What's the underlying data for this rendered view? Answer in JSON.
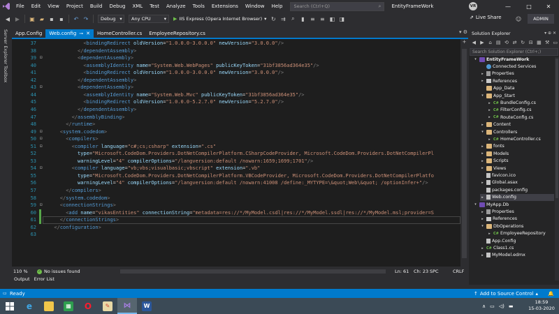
{
  "menu": {
    "items": [
      "File",
      "Edit",
      "View",
      "Project",
      "Build",
      "Debug",
      "XML",
      "Test",
      "Analyze",
      "Tools",
      "Extensions",
      "Window",
      "Help"
    ],
    "search_placeholder": "Search (Ctrl+Q)",
    "solution_name": "EntityFrameWork",
    "user_initials": "VR"
  },
  "toolbar": {
    "config": "Debug",
    "platform": "Any CPU",
    "run_label": "IIS Express (Opera Internet Browser)",
    "live_share": "Live Share",
    "admin": "ADMIN"
  },
  "side_tabs": [
    "Server Explorer",
    "Toolbox"
  ],
  "tabs": [
    {
      "label": "App.Config",
      "active": false
    },
    {
      "label": "Web.config",
      "active": true
    },
    {
      "label": "HomeController.cs",
      "active": false
    },
    {
      "label": "EmployeeRepository.cs",
      "active": false
    }
  ],
  "code": [
    {
      "n": "37",
      "i": 6,
      "s": [
        [
          "b",
          "<"
        ],
        [
          "t",
          "bindingRedirect "
        ],
        [
          "a",
          "oldVersion"
        ],
        [
          "p",
          "="
        ],
        [
          "v",
          "\"1.0.0.0-3.0.0.0\""
        ],
        [
          "p",
          " "
        ],
        [
          "a",
          "newVersion"
        ],
        [
          "p",
          "="
        ],
        [
          "v",
          "\"3.0.0.0\""
        ],
        [
          "b",
          "/>"
        ]
      ]
    },
    {
      "n": "38",
      "i": 5,
      "s": [
        [
          "b",
          "</"
        ],
        [
          "t",
          "dependentAssembly"
        ],
        [
          "b",
          ">"
        ]
      ]
    },
    {
      "n": "39",
      "i": 5,
      "f": "-",
      "s": [
        [
          "b",
          "<"
        ],
        [
          "t",
          "dependentAssembly"
        ],
        [
          "b",
          ">"
        ]
      ]
    },
    {
      "n": "40",
      "i": 6,
      "s": [
        [
          "b",
          "<"
        ],
        [
          "t",
          "assemblyIdentity "
        ],
        [
          "a",
          "name"
        ],
        [
          "p",
          "="
        ],
        [
          "v",
          "\"System.Web.WebPages\""
        ],
        [
          "p",
          " "
        ],
        [
          "a",
          "publicKeyToken"
        ],
        [
          "p",
          "="
        ],
        [
          "v",
          "\"31bf3856ad364e35\""
        ],
        [
          "b",
          "/>"
        ]
      ]
    },
    {
      "n": "41",
      "i": 6,
      "s": [
        [
          "b",
          "<"
        ],
        [
          "t",
          "bindingRedirect "
        ],
        [
          "a",
          "oldVersion"
        ],
        [
          "p",
          "="
        ],
        [
          "v",
          "\"1.0.0.0-3.0.0.0\""
        ],
        [
          "p",
          " "
        ],
        [
          "a",
          "newVersion"
        ],
        [
          "p",
          "="
        ],
        [
          "v",
          "\"3.0.0.0\""
        ],
        [
          "b",
          "/>"
        ]
      ]
    },
    {
      "n": "42",
      "i": 5,
      "s": [
        [
          "b",
          "</"
        ],
        [
          "t",
          "dependentAssembly"
        ],
        [
          "b",
          ">"
        ]
      ]
    },
    {
      "n": "43",
      "i": 5,
      "f": "-",
      "s": [
        [
          "b",
          "<"
        ],
        [
          "t",
          "dependentAssembly"
        ],
        [
          "b",
          ">"
        ]
      ]
    },
    {
      "n": "44",
      "i": 6,
      "s": [
        [
          "b",
          "<"
        ],
        [
          "t",
          "assemblyIdentity "
        ],
        [
          "a",
          "name"
        ],
        [
          "p",
          "="
        ],
        [
          "v",
          "\"System.Web.Mvc\""
        ],
        [
          "p",
          " "
        ],
        [
          "a",
          "publicKeyToken"
        ],
        [
          "p",
          "="
        ],
        [
          "v",
          "\"31bf3856ad364e35\""
        ],
        [
          "b",
          "/>"
        ]
      ]
    },
    {
      "n": "45",
      "i": 6,
      "s": [
        [
          "b",
          "<"
        ],
        [
          "t",
          "bindingRedirect "
        ],
        [
          "a",
          "oldVersion"
        ],
        [
          "p",
          "="
        ],
        [
          "v",
          "\"1.0.0.0-5.2.7.0\""
        ],
        [
          "p",
          " "
        ],
        [
          "a",
          "newVersion"
        ],
        [
          "p",
          "="
        ],
        [
          "v",
          "\"5.2.7.0\""
        ],
        [
          "b",
          "/>"
        ]
      ]
    },
    {
      "n": "46",
      "i": 5,
      "s": [
        [
          "b",
          "</"
        ],
        [
          "t",
          "dependentAssembly"
        ],
        [
          "b",
          ">"
        ]
      ]
    },
    {
      "n": "47",
      "i": 4,
      "s": [
        [
          "b",
          "</"
        ],
        [
          "t",
          "assemblyBinding"
        ],
        [
          "b",
          ">"
        ]
      ]
    },
    {
      "n": "48",
      "i": 3,
      "s": [
        [
          "b",
          "</"
        ],
        [
          "t",
          "runtime"
        ],
        [
          "b",
          ">"
        ]
      ]
    },
    {
      "n": "49",
      "i": 2,
      "f": "-",
      "s": [
        [
          "b",
          "<"
        ],
        [
          "t",
          "system.codedom"
        ],
        [
          "b",
          ">"
        ]
      ]
    },
    {
      "n": "50",
      "i": 3,
      "f": "-",
      "s": [
        [
          "b",
          "<"
        ],
        [
          "t",
          "compilers"
        ],
        [
          "b",
          ">"
        ]
      ]
    },
    {
      "n": "51",
      "i": 4,
      "f": "-",
      "s": [
        [
          "b",
          "<"
        ],
        [
          "t",
          "compiler "
        ],
        [
          "a",
          "language"
        ],
        [
          "p",
          "="
        ],
        [
          "v",
          "\"c#;cs;csharp\""
        ],
        [
          "p",
          " "
        ],
        [
          "a",
          "extension"
        ],
        [
          "p",
          "="
        ],
        [
          "v",
          "\".cs\""
        ]
      ]
    },
    {
      "n": "52",
      "i": 5,
      "s": [
        [
          "a",
          "type"
        ],
        [
          "p",
          "="
        ],
        [
          "v",
          "\"Microsoft.CodeDom.Providers.DotNetCompilerPlatform.CSharpCodeProvider, Microsoft.CodeDom.Providers.DotNetCompilerPl"
        ]
      ]
    },
    {
      "n": "53",
      "i": 5,
      "s": [
        [
          "a",
          "warningLevel"
        ],
        [
          "p",
          "="
        ],
        [
          "v",
          "\"4\""
        ],
        [
          "p",
          " "
        ],
        [
          "a",
          "compilerOptions"
        ],
        [
          "p",
          "="
        ],
        [
          "v",
          "\"/langversion:default /nowarn:1659;1699;1701\""
        ],
        [
          "b",
          "/>"
        ]
      ]
    },
    {
      "n": "54",
      "i": 4,
      "f": "-",
      "s": [
        [
          "b",
          "<"
        ],
        [
          "t",
          "compiler "
        ],
        [
          "a",
          "language"
        ],
        [
          "p",
          "="
        ],
        [
          "v",
          "\"vb;vbs;visualbasic;vbscript\""
        ],
        [
          "p",
          " "
        ],
        [
          "a",
          "extension"
        ],
        [
          "p",
          "="
        ],
        [
          "v",
          "\".vb\""
        ]
      ]
    },
    {
      "n": "55",
      "i": 5,
      "s": [
        [
          "a",
          "type"
        ],
        [
          "p",
          "="
        ],
        [
          "v",
          "\"Microsoft.CodeDom.Providers.DotNetCompilerPlatform.VBCodeProvider, Microsoft.CodeDom.Providers.DotNetCompilerPlatfo"
        ]
      ]
    },
    {
      "n": "56",
      "i": 5,
      "s": [
        [
          "a",
          "warningLevel"
        ],
        [
          "p",
          "="
        ],
        [
          "v",
          "\"4\""
        ],
        [
          "p",
          " "
        ],
        [
          "a",
          "compilerOptions"
        ],
        [
          "p",
          "="
        ],
        [
          "v",
          "\"/langversion:default /nowarn:41008 /define:_MYTYPE=\\&quot;Web\\&quot; /optionInfer+\""
        ],
        [
          "b",
          "/>"
        ]
      ]
    },
    {
      "n": "57",
      "i": 3,
      "s": [
        [
          "b",
          "</"
        ],
        [
          "t",
          "compilers"
        ],
        [
          "b",
          ">"
        ]
      ]
    },
    {
      "n": "58",
      "i": 2,
      "s": [
        [
          "b",
          "</"
        ],
        [
          "t",
          "system.codedom"
        ],
        [
          "b",
          ">"
        ]
      ]
    },
    {
      "n": "59",
      "i": 2,
      "f": "-",
      "s": [
        [
          "b",
          "<"
        ],
        [
          "t",
          "connectionStrings"
        ],
        [
          "b",
          ">"
        ]
      ]
    },
    {
      "n": "60",
      "i": 3,
      "s": [
        [
          "b",
          "<"
        ],
        [
          "t",
          "add "
        ],
        [
          "a",
          "name"
        ],
        [
          "p",
          "="
        ],
        [
          "v",
          "\"vikasEntities\""
        ],
        [
          "p",
          " "
        ],
        [
          "a",
          "connectionString"
        ],
        [
          "p",
          "="
        ],
        [
          "v",
          "\"metadata=res://*/MyModel.csdl|res://*/MyModel.ssdl|res://*/MyModel.msl;provider=S"
        ]
      ]
    },
    {
      "n": "61",
      "i": 2,
      "cur": true,
      "s": [
        [
          "b",
          "</"
        ],
        [
          "t",
          "connectionStrings"
        ],
        [
          "b",
          ">"
        ]
      ]
    },
    {
      "n": "62",
      "i": 1,
      "s": [
        [
          "b",
          "</"
        ],
        [
          "t",
          "configuration"
        ],
        [
          "b",
          ">"
        ]
      ]
    },
    {
      "n": "63",
      "i": 0,
      "s": []
    }
  ],
  "editor_status": {
    "zoom": "110 %",
    "issues": "No issues found",
    "line": "Ln: 61",
    "char": "Ch: 23",
    "ins": "SPC",
    "eol": "CRLF"
  },
  "panel_tabs": [
    "Output",
    "Error List"
  ],
  "solution_explorer": {
    "title": "Solution Explorer",
    "search_placeholder": "Search Solution Explorer (Ctrl+;)",
    "tree": [
      {
        "label": "EntityFrameWork",
        "d": 0,
        "tw": "▾",
        "icon": "proj",
        "bold": true
      },
      {
        "label": "Connected Services",
        "d": 1,
        "tw": "",
        "icon": "conn"
      },
      {
        "label": "Properties",
        "d": 1,
        "tw": "▸",
        "icon": "props"
      },
      {
        "label": "References",
        "d": 1,
        "tw": "▸",
        "icon": "refs"
      },
      {
        "label": "App_Data",
        "d": 1,
        "tw": "",
        "icon": "folder"
      },
      {
        "label": "App_Start",
        "d": 1,
        "tw": "▾",
        "icon": "folder"
      },
      {
        "label": "BundleConfig.cs",
        "d": 2,
        "tw": "▸",
        "icon": "cs"
      },
      {
        "label": "FilterConfig.cs",
        "d": 2,
        "tw": "▸",
        "icon": "cs"
      },
      {
        "label": "RouteConfig.cs",
        "d": 2,
        "tw": "▸",
        "icon": "cs"
      },
      {
        "label": "Content",
        "d": 1,
        "tw": "▸",
        "icon": "folder"
      },
      {
        "label": "Controllers",
        "d": 1,
        "tw": "▾",
        "icon": "folder"
      },
      {
        "label": "HomeController.cs",
        "d": 2,
        "tw": "▸",
        "icon": "cs"
      },
      {
        "label": "fonts",
        "d": 1,
        "tw": "▸",
        "icon": "folder"
      },
      {
        "label": "Models",
        "d": 1,
        "tw": "▸",
        "icon": "folder"
      },
      {
        "label": "Scripts",
        "d": 1,
        "tw": "▸",
        "icon": "folder"
      },
      {
        "label": "Views",
        "d": 1,
        "tw": "▸",
        "icon": "folder"
      },
      {
        "label": "favicon.ico",
        "d": 1,
        "tw": "",
        "icon": "file"
      },
      {
        "label": "Global.asax",
        "d": 1,
        "tw": "▸",
        "icon": "file"
      },
      {
        "label": "packages.config",
        "d": 1,
        "tw": "",
        "icon": "file"
      },
      {
        "label": "Web.config",
        "d": 1,
        "tw": "▸",
        "icon": "file",
        "selected": true
      },
      {
        "label": "MyApp.Db",
        "d": 0,
        "tw": "▾",
        "icon": "proj"
      },
      {
        "label": "Properties",
        "d": 1,
        "tw": "▸",
        "icon": "props"
      },
      {
        "label": "References",
        "d": 1,
        "tw": "▸",
        "icon": "refs"
      },
      {
        "label": "DbOperations",
        "d": 1,
        "tw": "▾",
        "icon": "folder"
      },
      {
        "label": "EmployeeRepository",
        "d": 2,
        "tw": "▸",
        "icon": "cs"
      },
      {
        "label": "App.Config",
        "d": 1,
        "tw": "",
        "icon": "file"
      },
      {
        "label": "Class1.cs",
        "d": 1,
        "tw": "▸",
        "icon": "cs"
      },
      {
        "label": "MyModel.edmx",
        "d": 1,
        "tw": "▸",
        "icon": "file"
      }
    ]
  },
  "statusbar": {
    "ready": "Ready",
    "source_control": "Add to Source Control"
  },
  "taskbar": {
    "time": "18:59",
    "date": "15-03-2020"
  },
  "colors": {
    "accent": "#007acc",
    "editor_bg": "#1e1e1e",
    "chrome_bg": "#2d2d30",
    "taskbar_bg": "#3b4a56"
  }
}
